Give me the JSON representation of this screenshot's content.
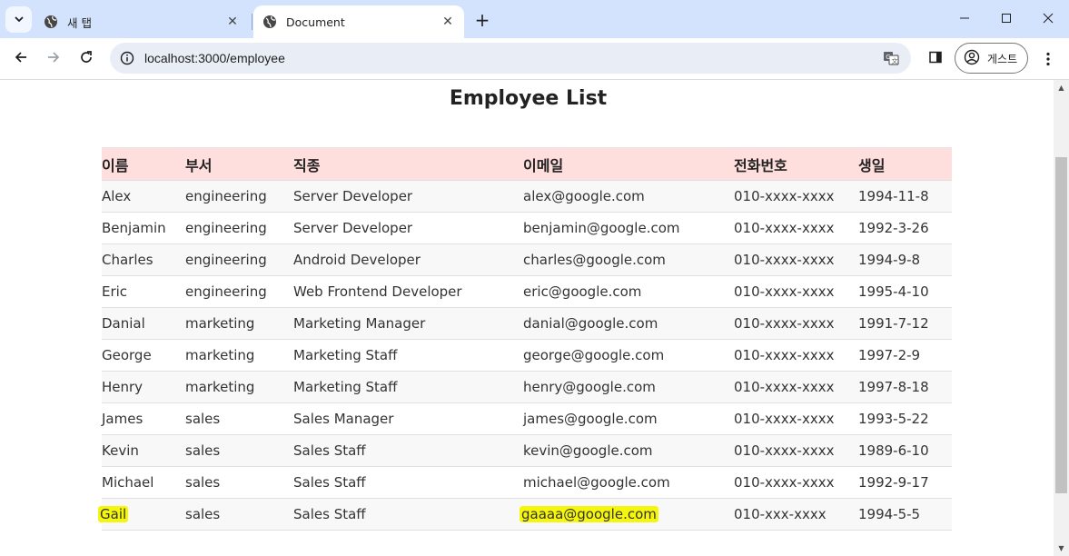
{
  "browser": {
    "tabs": [
      {
        "title": "새 탭",
        "active": false
      },
      {
        "title": "Document",
        "active": true
      }
    ],
    "new_tab_symbol": "+",
    "address": "localhost:3000/employee",
    "profile_label": "게스트",
    "icons": [
      "tab-search-icon",
      "globe-icon",
      "close-icon",
      "back-arrow-icon",
      "forward-arrow-icon",
      "reload-icon",
      "info-icon",
      "translate-icon",
      "side-panel-icon",
      "profile-icon",
      "more-vert-icon",
      "minimize-icon",
      "maximize-icon",
      "window-close-icon"
    ]
  },
  "page": {
    "title": "Employee List",
    "columns": [
      "이름",
      "부서",
      "직종",
      "이메일",
      "전화번호",
      "생일"
    ],
    "rows": [
      [
        "Alex",
        "engineering",
        "Server Developer",
        "alex@google.com",
        "010-xxxx-xxxx",
        "1994-11-8"
      ],
      [
        "Benjamin",
        "engineering",
        "Server Developer",
        "benjamin@google.com",
        "010-xxxx-xxxx",
        "1992-3-26"
      ],
      [
        "Charles",
        "engineering",
        "Android Developer",
        "charles@google.com",
        "010-xxxx-xxxx",
        "1994-9-8"
      ],
      [
        "Eric",
        "engineering",
        "Web Frontend Developer",
        "eric@google.com",
        "010-xxxx-xxxx",
        "1995-4-10"
      ],
      [
        "Danial",
        "marketing",
        "Marketing Manager",
        "danial@google.com",
        "010-xxxx-xxxx",
        "1991-7-12"
      ],
      [
        "George",
        "marketing",
        "Marketing Staff",
        "george@google.com",
        "010-xxxx-xxxx",
        "1997-2-9"
      ],
      [
        "Henry",
        "marketing",
        "Marketing Staff",
        "henry@google.com",
        "010-xxxx-xxxx",
        "1997-8-18"
      ],
      [
        "James",
        "sales",
        "Sales Manager",
        "james@google.com",
        "010-xxxx-xxxx",
        "1993-5-22"
      ],
      [
        "Kevin",
        "sales",
        "Sales Staff",
        "kevin@google.com",
        "010-xxxx-xxxx",
        "1989-6-10"
      ],
      [
        "Michael",
        "sales",
        "Sales Staff",
        "michael@google.com",
        "010-xxxx-xxxx",
        "1992-9-17"
      ],
      [
        "Gail",
        "sales",
        "Sales Staff",
        "gaaaa@google.com",
        "010-xxx-xxxx",
        "1994-5-5"
      ]
    ],
    "highlighted_row": 10,
    "highlight_color": "#f6f60c",
    "header_bg": "#ffdede"
  }
}
